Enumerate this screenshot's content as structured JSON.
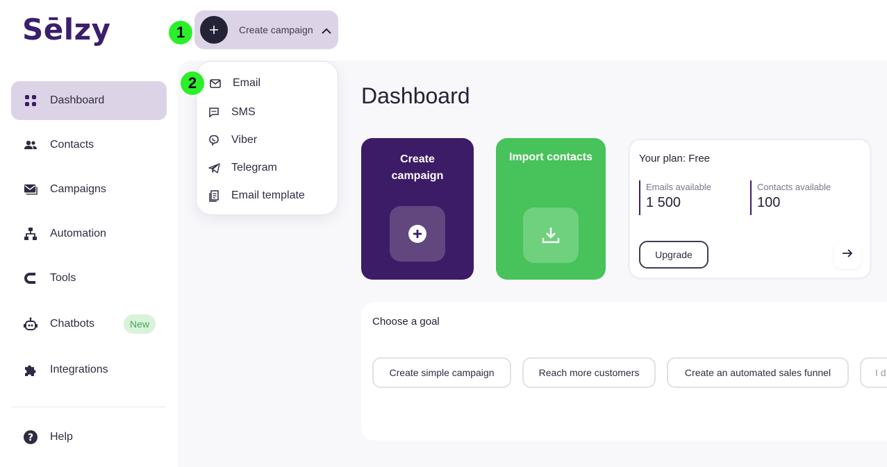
{
  "brand": {
    "logo_text": "Sēlzy",
    "accent_color": "#3c1c66",
    "green_color": "#48c25a"
  },
  "sidebar": {
    "items": [
      {
        "label": "Dashboard",
        "icon": "grid-icon",
        "active": true
      },
      {
        "label": "Contacts",
        "icon": "people-icon"
      },
      {
        "label": "Campaigns",
        "icon": "mail-icon"
      },
      {
        "label": "Automation",
        "icon": "hierarchy-icon"
      },
      {
        "label": "Tools",
        "icon": "magnet-icon"
      },
      {
        "label": "Chatbots",
        "icon": "robot-icon",
        "badge": "New"
      },
      {
        "label": "Integrations",
        "icon": "puzzle-icon"
      }
    ],
    "help_label": "Help"
  },
  "header": {
    "create_campaign_label": "Create campaign",
    "step1": "1",
    "step2": "2"
  },
  "dropdown": {
    "items": [
      {
        "label": "Email",
        "icon": "envelope-icon"
      },
      {
        "label": "SMS",
        "icon": "chat-bubble-icon"
      },
      {
        "label": "Viber",
        "icon": "viber-icon"
      },
      {
        "label": "Telegram",
        "icon": "paper-plane-icon"
      },
      {
        "label": "Email template",
        "icon": "document-icon"
      }
    ]
  },
  "main": {
    "title": "Dashboard",
    "create_card": {
      "title_line1": "Create",
      "title_line2": "campaign"
    },
    "import_card": {
      "title": "Import contacts"
    },
    "plan_card": {
      "title": "Your plan: Free",
      "emails_label": "Emails available",
      "emails_value": "1 500",
      "contacts_label": "Contacts available",
      "contacts_value": "100",
      "upgrade_label": "Upgrade"
    },
    "goal_panel": {
      "title": "Choose a goal",
      "goals": [
        "Create simple campaign",
        "Reach more customers",
        "Create an automated sales funnel",
        "I d"
      ]
    }
  }
}
